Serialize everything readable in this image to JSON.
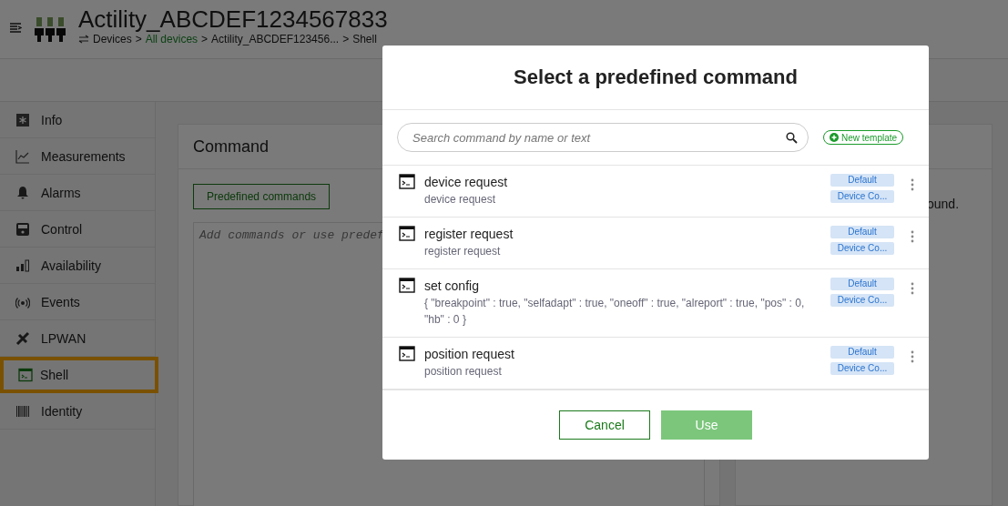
{
  "header": {
    "title": "Actility_ABCDEF1234567833",
    "breadcrumb": [
      {
        "label": "Devices",
        "link": false
      },
      {
        "label": "All devices",
        "link": true
      },
      {
        "label": "Actility_ABCDEF123456...",
        "link": false
      },
      {
        "label": "Shell",
        "link": false
      }
    ],
    "separators": [
      ">",
      ">",
      ">"
    ]
  },
  "sidebar": {
    "items": [
      {
        "label": "Info",
        "kind": "info",
        "selected": false
      },
      {
        "label": "Measurements",
        "kind": "chart",
        "selected": false
      },
      {
        "label": "Alarms",
        "kind": "bell",
        "selected": false
      },
      {
        "label": "Control",
        "kind": "control",
        "selected": false
      },
      {
        "label": "Availability",
        "kind": "bars",
        "selected": false
      },
      {
        "label": "Events",
        "kind": "events",
        "selected": false
      },
      {
        "label": "LPWAN",
        "kind": "lpwan",
        "selected": false
      },
      {
        "label": "Shell",
        "kind": "shell",
        "selected": true
      },
      {
        "label": "Identity",
        "kind": "barcode",
        "selected": false
      }
    ]
  },
  "command_card": {
    "title": "Command",
    "button": "Predefined commands",
    "placeholder": "Add commands or use predef"
  },
  "right_card": {
    "text": "ound."
  },
  "dialog": {
    "title": "Select a predefined command",
    "search": {
      "placeholder": "Search command by name or text"
    },
    "new_button": "New template",
    "commands": [
      {
        "name": "device request",
        "text": "device request",
        "tags": [
          "Default",
          "Device Co..."
        ]
      },
      {
        "name": "register request",
        "text": "register request",
        "tags": [
          "Default",
          "Device Co..."
        ]
      },
      {
        "name": "set config",
        "text": "{ \"breakpoint\" : true, \"selfadapt\" : true, \"oneoff\" : true, \"alreport\" : true, \"pos\" : 0, \"hb\" : 0 }",
        "tags": [
          "Default",
          "Device Co..."
        ]
      },
      {
        "name": "position request",
        "text": "position request",
        "tags": [
          "Default",
          "Device Co..."
        ]
      }
    ],
    "buttons": [
      {
        "label": "Cancel",
        "kind": "secondary"
      },
      {
        "label": "Use",
        "kind": "primary"
      }
    ]
  }
}
